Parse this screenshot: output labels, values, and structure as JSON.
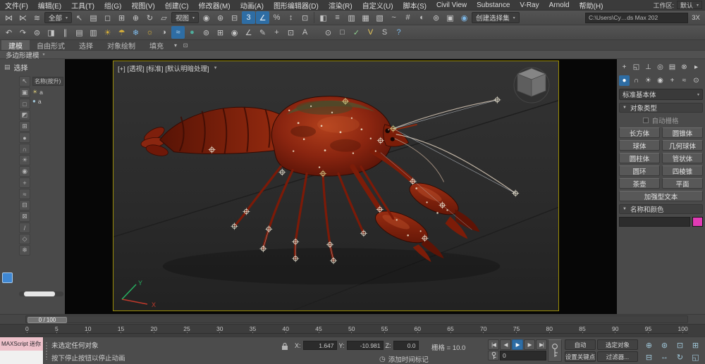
{
  "colors": {
    "accent_blue": "#2e6da4",
    "viewport_border": "#9b8d07",
    "object_color_swatch": "#e13bb5"
  },
  "ui": {
    "caret": "▼",
    "caret_small": "▾"
  },
  "menu": {
    "items": [
      "文件(F)",
      "编辑(E)",
      "工具(T)",
      "组(G)",
      "视图(V)",
      "创建(C)",
      "修改器(M)",
      "动画(A)",
      "图形编辑器(D)",
      "渲染(R)",
      "自定义(U)",
      "脚本(S)",
      "Civil View",
      "Substance",
      "V-Ray",
      "Arnold",
      "帮助(H)"
    ],
    "workspace_label": "工作区:",
    "workspace_value": "默认"
  },
  "toolbar_main": {
    "g1": [
      {
        "name": "select-and-link-icon",
        "glyph": "⋈"
      },
      {
        "name": "unlink-selection-icon",
        "glyph": "⋉"
      },
      {
        "name": "bind-to-space-warp-icon",
        "glyph": "≋"
      }
    ],
    "selection_filter": "全部",
    "g2": [
      {
        "name": "select-object-icon",
        "glyph": "↖"
      },
      {
        "name": "select-by-name-icon",
        "glyph": "▤"
      },
      {
        "name": "rectangular-selection-region-icon",
        "glyph": "◻"
      },
      {
        "name": "window-crossing-toggle-icon",
        "glyph": "⊞"
      },
      {
        "name": "select-and-move-icon",
        "glyph": "⊕"
      },
      {
        "name": "select-and-rotate-icon",
        "glyph": "↻"
      },
      {
        "name": "select-and-scale-icon",
        "glyph": "▱"
      }
    ],
    "coord_system": "视图",
    "g3": [
      {
        "name": "use-pivot-center-icon",
        "glyph": "◉"
      },
      {
        "name": "select-and-manipulate-icon",
        "glyph": "⊛"
      },
      {
        "name": "keyboard-shortcut-override-icon",
        "glyph": "⊟"
      },
      {
        "name": "snap-toggle-3d-icon",
        "glyph": "3",
        "hl": true
      },
      {
        "name": "angle-snap-icon",
        "glyph": "∠",
        "hl": true
      },
      {
        "name": "percent-snap-icon",
        "glyph": "%"
      },
      {
        "name": "spinner-snap-icon",
        "glyph": "↕"
      },
      {
        "name": "named-selection-sets-icon",
        "glyph": "⊡"
      }
    ],
    "g4": [
      {
        "name": "mirror-icon",
        "glyph": "◧"
      },
      {
        "name": "align-icon",
        "glyph": "≡"
      },
      {
        "name": "toggle-scene-explorer-icon",
        "glyph": "▥"
      },
      {
        "name": "toggle-layer-explorer-icon",
        "glyph": "▦"
      },
      {
        "name": "toggle-ribbon-icon",
        "glyph": "▧"
      },
      {
        "name": "curve-editor-icon",
        "glyph": "~"
      },
      {
        "name": "schematic-view-icon",
        "glyph": "#"
      },
      {
        "name": "material-editor-icon",
        "glyph": "◐"
      },
      {
        "name": "render-setup-icon",
        "glyph": "⊚"
      },
      {
        "name": "rendered-frame-window-icon",
        "glyph": "▣"
      },
      {
        "name": "render-production-icon",
        "glyph": "◉",
        "c": "#7db8e8"
      }
    ],
    "named_selection": "创建选择集",
    "project_path": "C:\\Users\\Cy…ds Max 202",
    "badge": "3X"
  },
  "toolbar_secondary": {
    "icons": [
      {
        "name": "undo-icon",
        "glyph": "↶"
      },
      {
        "name": "redo-icon",
        "glyph": "↷"
      },
      {
        "name": "select-and-place-icon",
        "glyph": "⊜"
      },
      {
        "name": "mirror-tool-icon",
        "glyph": "◨"
      },
      {
        "name": "align-tool-icon",
        "glyph": "∥"
      },
      {
        "name": "layer-manager-icon",
        "glyph": "▤"
      },
      {
        "name": "scene-explorer-toolbar-icon",
        "glyph": "▥"
      },
      {
        "name": "daylight-icon",
        "glyph": "☀",
        "c": "#d9b13a"
      },
      {
        "name": "umbrella-icon",
        "glyph": "☂",
        "c": "#d9b13a"
      },
      {
        "name": "snowflake-icon",
        "glyph": "❄",
        "c": "#7db8e8"
      },
      {
        "name": "sun-positioner-icon",
        "glyph": "☼",
        "c": "#d9b13a"
      },
      {
        "name": "exposure-control-icon",
        "glyph": "◑"
      },
      {
        "name": "environment-icon",
        "glyph": "≈",
        "c": "#bcd9ee",
        "hl": true
      },
      {
        "name": "material-ball-icon",
        "glyph": "●",
        "c": "#4fae9c"
      },
      {
        "name": "render-setup-secondary-icon",
        "glyph": "⊚"
      },
      {
        "name": "state-sets-icon",
        "glyph": "⊞"
      },
      {
        "name": "camera-tool-icon",
        "glyph": "◉"
      },
      {
        "name": "measure-icon",
        "glyph": "∠"
      },
      {
        "name": "paint-tool-icon",
        "glyph": "✎"
      },
      {
        "name": "grid-tool-icon",
        "glyph": "+"
      },
      {
        "name": "clone-tool-icon",
        "glyph": "⊡"
      },
      {
        "name": "arnold-tool-icon",
        "glyph": "A"
      }
    ],
    "right_icons": [
      {
        "name": "isolate-selection-icon",
        "glyph": "⊙"
      },
      {
        "name": "display-toggle-icon",
        "glyph": "□"
      },
      {
        "name": "checkmark-icon",
        "glyph": "✓",
        "c": "#8fd18f"
      },
      {
        "name": "vray-toolbar-icon",
        "glyph": "V",
        "c": "#e8c85a"
      },
      {
        "name": "substance-toolbar-icon",
        "glyph": "S"
      },
      {
        "name": "help-icon",
        "glyph": "?",
        "c": "#7db8e8"
      }
    ]
  },
  "ribbon": {
    "tabs": [
      {
        "name": "ribbon-tab-modeling",
        "label": "建模",
        "active": true
      },
      {
        "name": "ribbon-tab-freeform",
        "label": "自由形式"
      },
      {
        "name": "ribbon-tab-selection",
        "label": "选择"
      },
      {
        "name": "ribbon-tab-object-paint",
        "label": "对象绘制"
      },
      {
        "name": "ribbon-tab-populate",
        "label": "填充"
      }
    ],
    "subtab": "多边形建模"
  },
  "explorer": {
    "title": "选择",
    "title_icon": "▤",
    "column_header": "名称(按升)",
    "strip_icons": [
      {
        "name": "explorer-pick-icon",
        "glyph": "↖"
      },
      {
        "name": "explorer-select-all-icon",
        "glyph": "▣"
      },
      {
        "name": "explorer-select-none-icon",
        "glyph": "□"
      },
      {
        "name": "explorer-select-invert-icon",
        "glyph": "◩"
      },
      {
        "name": "explorer-show-all-icon",
        "glyph": "⊞"
      },
      {
        "name": "explorer-geometry-filter-icon",
        "glyph": "●"
      },
      {
        "name": "explorer-shapes-filter-icon",
        "glyph": "∩"
      },
      {
        "name": "explorer-lights-filter-icon",
        "glyph": "☀"
      },
      {
        "name": "explorer-cameras-filter-icon",
        "glyph": "◉"
      },
      {
        "name": "explorer-helpers-filter-icon",
        "glyph": "+"
      },
      {
        "name": "explorer-spacewarps-filter-icon",
        "glyph": "≈"
      },
      {
        "name": "explorer-groups-filter-icon",
        "glyph": "⊟"
      },
      {
        "name": "explorer-xrefs-filter-icon",
        "glyph": "⊠"
      },
      {
        "name": "explorer-bones-filter-icon",
        "glyph": "/"
      },
      {
        "name": "explorer-containers-filter-icon",
        "glyph": "◇"
      },
      {
        "name": "explorer-frozen-filter-icon",
        "glyph": "❄"
      }
    ],
    "rows": [
      {
        "name": "scene-object-row",
        "glyph": "☀",
        "label": "a",
        "c": "#d8c878"
      },
      {
        "name": "scene-object-row",
        "glyph": "●",
        "label": "a",
        "c": "#9fc6d8"
      }
    ]
  },
  "viewport": {
    "label": "[+] [透视] [标准] [默认明暗处理]",
    "axis_x": "X",
    "axis_y": "Y"
  },
  "command_panel": {
    "tabs": [
      {
        "name": "create-tab-icon",
        "glyph": "+"
      },
      {
        "name": "modify-tab-icon",
        "glyph": "◱"
      },
      {
        "name": "hierarchy-tab-icon",
        "glyph": "⊥"
      },
      {
        "name": "motion-tab-icon",
        "glyph": "◎"
      },
      {
        "name": "display-tab-icon",
        "glyph": "▤"
      },
      {
        "name": "utilities-tab-icon",
        "glyph": "⊗"
      },
      {
        "name": "panel-expand-icon",
        "glyph": "▸"
      }
    ],
    "categories": [
      {
        "name": "geometry-category-icon",
        "glyph": "●",
        "hl": true
      },
      {
        "name": "shapes-category-icon",
        "glyph": "∩"
      },
      {
        "name": "lights-category-icon",
        "glyph": "☀"
      },
      {
        "name": "cameras-category-icon",
        "glyph": "◉"
      },
      {
        "name": "helpers-category-icon",
        "glyph": "+"
      },
      {
        "name": "space-warps-category-icon",
        "glyph": "≈"
      },
      {
        "name": "systems-category-icon",
        "glyph": "⊙"
      }
    ],
    "dropdown": "标准基本体",
    "object_type": {
      "title": "对象类型",
      "autogrid": "自动栅格",
      "buttons": [
        "长方体",
        "圆锥体",
        "球体",
        "几何球体",
        "圆柱体",
        "管状体",
        "圆环",
        "四棱锥",
        "茶壶",
        "平面"
      ],
      "wide_button": "加强型文本"
    },
    "name_color": {
      "title": "名称和颜色"
    }
  },
  "timeline": {
    "slider": "0 / 100",
    "ticks": [
      "0",
      "5",
      "10",
      "15",
      "20",
      "25",
      "30",
      "35",
      "40",
      "45",
      "50",
      "55",
      "60",
      "65",
      "70",
      "75",
      "80",
      "85",
      "90",
      "95",
      "100"
    ]
  },
  "status": {
    "mini": "MAXScript 迷你",
    "line1": "未选定任何对象",
    "line2": "按下停止按钮以停止动画",
    "x_label": "X:",
    "x_value": "1.647",
    "y_label": "Y:",
    "y_value": "-10.981",
    "z_label": "Z:",
    "z_value": "0.0",
    "grid_label": "栅格 = 10.0",
    "clock_glyph": "◷",
    "time_tag": "添加时间标记",
    "frame_value": "0",
    "auto_label": "自动",
    "selected_label": "选定对象",
    "set_key_label": "设置关键点",
    "filters_label": "过滤器...",
    "playback": [
      {
        "name": "go-to-start-button",
        "glyph": "|◀"
      },
      {
        "name": "previous-frame-button",
        "glyph": "◀"
      },
      {
        "name": "play-button",
        "glyph": "▶",
        "hl": true
      },
      {
        "name": "next-frame-button",
        "glyph": "▶"
      },
      {
        "name": "go-to-end-button",
        "glyph": "▶|"
      }
    ],
    "nav_icons": [
      {
        "name": "zoom-icon",
        "glyph": "⊕",
        "c": "#9fc6d8"
      },
      {
        "name": "zoom-all-icon",
        "glyph": "⊛",
        "c": "#9fc6d8"
      },
      {
        "name": "zoom-extents-icon",
        "glyph": "⊡",
        "c": "#9fc6d8"
      },
      {
        "name": "zoom-extents-all-icon",
        "glyph": "⊞",
        "c": "#9fc6d8"
      },
      {
        "name": "zoom-region-icon",
        "glyph": "⊟",
        "c": "#9fc6d8"
      },
      {
        "name": "pan-view-icon",
        "glyph": "↔",
        "c": "#9fc6d8"
      },
      {
        "name": "orbit-icon",
        "glyph": "↻",
        "c": "#9fc6d8"
      },
      {
        "name": "maximize-viewport-toggle-icon",
        "glyph": "◱",
        "c": "#9fc6d8"
      }
    ]
  }
}
